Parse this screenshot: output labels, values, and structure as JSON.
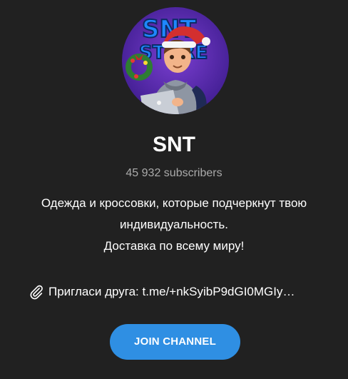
{
  "channel": {
    "title": "SNT",
    "subscribers": "45 932 subscribers",
    "description": [
      "Одежда и кроссовки, которые подчеркнут твою",
      "индивидуальность.",
      "Доставка по всему миру!"
    ],
    "invite_text": "Пригласи друга: t.me/+nkSyibP9dGI0MGIy…",
    "avatar_logo_text": "SNT STORE"
  },
  "actions": {
    "join_label": "JOIN CHANNEL"
  },
  "colors": {
    "background": "#212121",
    "accent": "#2f8fe3",
    "muted_text": "#aaaaaa",
    "text": "#ffffff"
  },
  "icons": {
    "invite": "paperclip-icon"
  }
}
